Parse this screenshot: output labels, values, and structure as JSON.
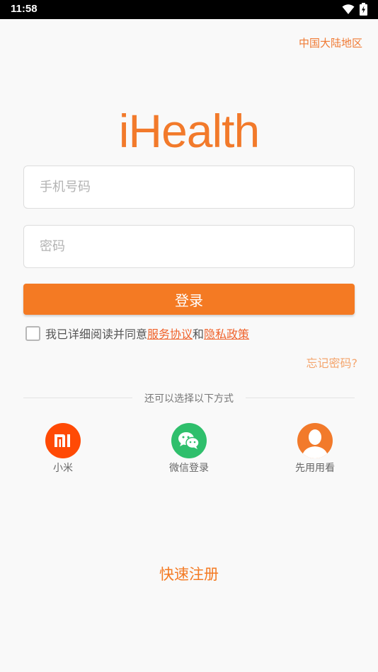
{
  "status_bar": {
    "time": "11:58"
  },
  "region": "中国大陆地区",
  "logo": "iHealth",
  "phone_field": {
    "placeholder": "手机号码",
    "value": ""
  },
  "password_field": {
    "placeholder": "密码",
    "value": ""
  },
  "login_button": "登录",
  "agreement": {
    "prefix": "我已详细阅读并同意",
    "service_link": "服务协议",
    "connector": "和",
    "privacy_link": "隐私政策",
    "checked": false
  },
  "forgot_password": "忘记密码?",
  "divider_text": "还可以选择以下方式",
  "login_options": [
    {
      "label": "小米",
      "icon": "xiaomi-icon",
      "color": "#ff4a05"
    },
    {
      "label": "微信登录",
      "icon": "wechat-icon",
      "color": "#2fbf6c"
    },
    {
      "label": "先用用看",
      "icon": "user-avatar-icon",
      "color": "#f27a2b"
    }
  ],
  "quick_register": "快速注册",
  "colors": {
    "accent": "#f47a23",
    "link": "#f0632c",
    "background": "#f9f9f9"
  }
}
